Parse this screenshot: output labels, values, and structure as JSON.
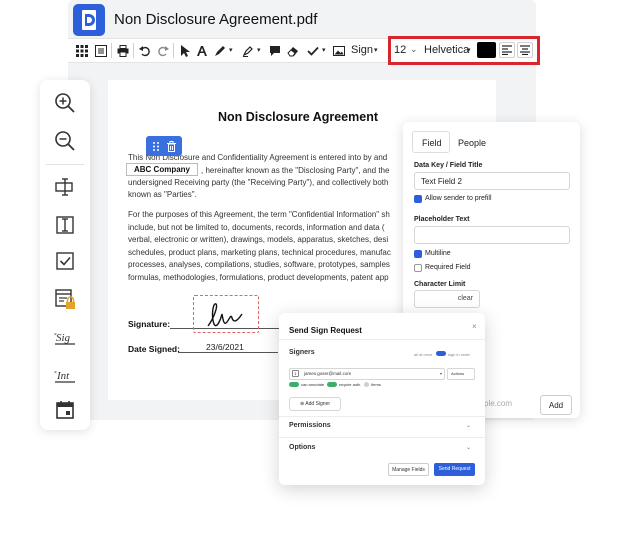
{
  "app": {
    "title": "Non Disclosure Agreement.pdf"
  },
  "toolbar": {
    "sign_label": "Sign",
    "font_size": "12",
    "font_size_chevron": "⌄",
    "font_family": "Helvetica",
    "caret": "▾",
    "text_color": "#000000",
    "highlight_color": "#d9262c"
  },
  "document": {
    "title": "Non Disclosure Agreement",
    "paragraph1": [
      "This Non Disclosure and Confidentiality Agreement is entered into by and",
      "",
      "undersigned Receiving party (the \"Receiving Party\"), and collectively both",
      "known as \"Parties\"."
    ],
    "paragraph1_line2_suffix": ", hereinafter known as the \"Disclosing Party\", and the",
    "company_field": "ABC Company",
    "paragraph2": [
      "For the purposes of this Agreement, the term \"Confidential Information\" sh",
      "include, but not be limited to, documents, records, information and data (",
      "verbal, electronic or written), drawings, models, apparatus, sketches, desi",
      "schedules, product plans, marketing plans, technical procedures, manufac",
      "processes, analyses, compilations, studies, software, prototypes, samples",
      "formulas, methodologies, formulations, product developments, patent app"
    ],
    "signature_label": "Signature:",
    "date_label": "Date Signed:",
    "date_value": "23/6/2021"
  },
  "field_panel": {
    "tabs": [
      "Field",
      "People"
    ],
    "data_key_label": "Data Key / Field Title",
    "data_key_value": "Text Field 2",
    "allow_prefill_label": "Allow sender to prefill",
    "placeholder_label": "Placeholder Text",
    "placeholder_value": "",
    "multiline_label": "Multiline",
    "required_label": "Required Field",
    "char_limit_label": "Character Limit",
    "clear_label": "clear",
    "email_placeholder": "ple.com",
    "add_label": "Add"
  },
  "dialog": {
    "title": "Send Sign Request",
    "close": "×",
    "signers_label": "Signers",
    "all_at_once": "all at once",
    "sign_in_order": "sign in order",
    "signer_number": "1",
    "signer_email": "james.goser@mail.com",
    "actions_label": "Actions",
    "option_can_annotate": "can annotate",
    "option_require_auth": "require auth",
    "option_items": "Items",
    "add_signer": "Add Signer",
    "permissions_label": "Permissions",
    "options_label": "Options",
    "manage_fields": "Manage Fields",
    "send_request": "Send Request"
  }
}
